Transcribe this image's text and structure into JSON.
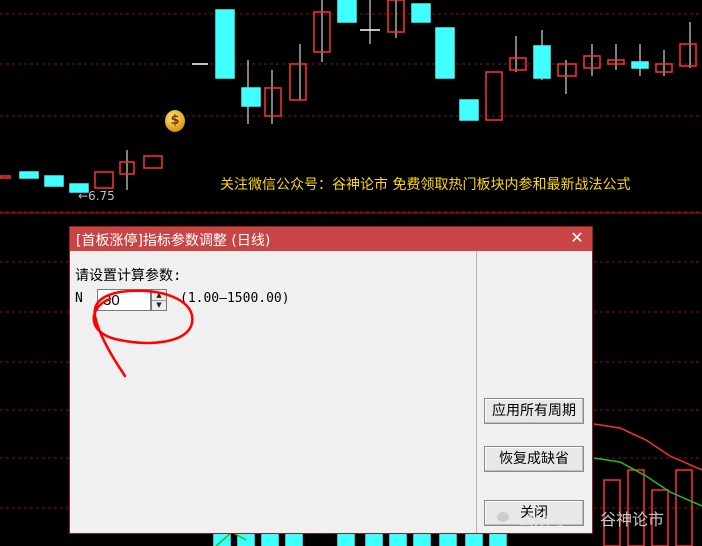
{
  "chart": {
    "banner_text": "关注微信公众号：谷神论市    免费领取热门板块内参和最新战法公式",
    "price_label": "←6.75",
    "colors": {
      "up": "#ff3030",
      "down": "#40ffff",
      "grid": "#8a1010",
      "white": "#ffffff",
      "ma_red": "#ff3030",
      "ma_green": "#20c020"
    },
    "candles": [
      {
        "o": 8.2,
        "c": 8.2,
        "h": 8.3,
        "l": 8.1,
        "col": "up"
      },
      {
        "o": 8.25,
        "c": 8.05,
        "h": 8.3,
        "l": 8.0,
        "col": "down"
      },
      {
        "o": 8.1,
        "c": 7.95,
        "h": 8.2,
        "l": 7.9,
        "col": "down"
      },
      {
        "o": 7.9,
        "c": 7.7,
        "h": 8.0,
        "l": 7.6,
        "col": "down"
      },
      {
        "o": 7.7,
        "c": 8.3,
        "h": 8.6,
        "l": 6.75,
        "col": "up"
      },
      {
        "o": 8.3,
        "c": 8.6,
        "h": 9.1,
        "l": 8.2,
        "col": "up"
      },
      {
        "o": 8.6,
        "c": 9.2,
        "h": 9.2,
        "l": 8.6,
        "col": "up"
      }
    ]
  },
  "dialog": {
    "title": "[首板涨停]指标参数调整 (日线)",
    "close_glyph": "✕",
    "prompt": "请设置计算参数:",
    "param_label": "N",
    "param_value": "30",
    "range": "(1.00—1500.00)",
    "spin_up": "▲",
    "spin_down": "▼",
    "buttons": {
      "apply_all": "应用所有周期",
      "restore_default": "恢复成缺省",
      "close": "关闭"
    }
  },
  "watermark": {
    "text": "公众号 ·",
    "brand": "谷神论市"
  }
}
